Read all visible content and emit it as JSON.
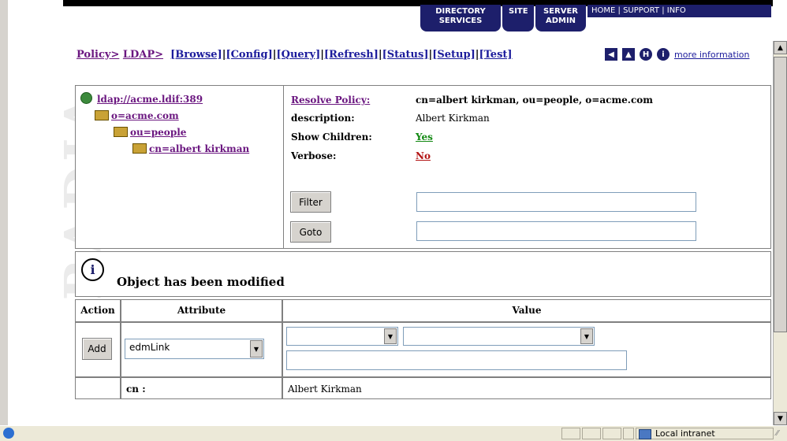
{
  "watermark": "RADIA",
  "topnav": {
    "tabs": [
      "DIRECTORY SERVICES",
      "SITE",
      "SERVER ADMIN"
    ],
    "util": [
      "HOME",
      "SUPPORT",
      "INFO"
    ]
  },
  "breadcrumb": {
    "policy": "Policy>",
    "ldap": "LDAP>",
    "actions": [
      "[Browse]",
      "[Config]",
      "[Query]",
      "[Refresh]",
      "[Status]",
      "[Setup]",
      "[Test]"
    ],
    "more_info": "more information"
  },
  "tree": {
    "root": "ldap://acme.ldif:389",
    "org": "o=acme.com",
    "ou": "ou=people",
    "cn": "cn=albert kirkman"
  },
  "properties": {
    "resolve_label": "Resolve Policy:",
    "resolve_value": "cn=albert kirkman, ou=people, o=acme.com",
    "description_label": "description:",
    "description_value": "Albert Kirkman",
    "show_children_label": "Show Children:",
    "show_children_value": "Yes",
    "verbose_label": "Verbose:",
    "verbose_value": "No",
    "filter_button": "Filter",
    "goto_button": "Goto"
  },
  "message": "Object has been modified",
  "attr_table": {
    "headers": [
      "Action",
      "Attribute",
      "Value"
    ],
    "add_button": "Add",
    "attribute_select": "edmLink",
    "row_attr": "cn :",
    "row_value": "Albert Kirkman"
  },
  "statusbar": {
    "zone": "Local intranet"
  }
}
